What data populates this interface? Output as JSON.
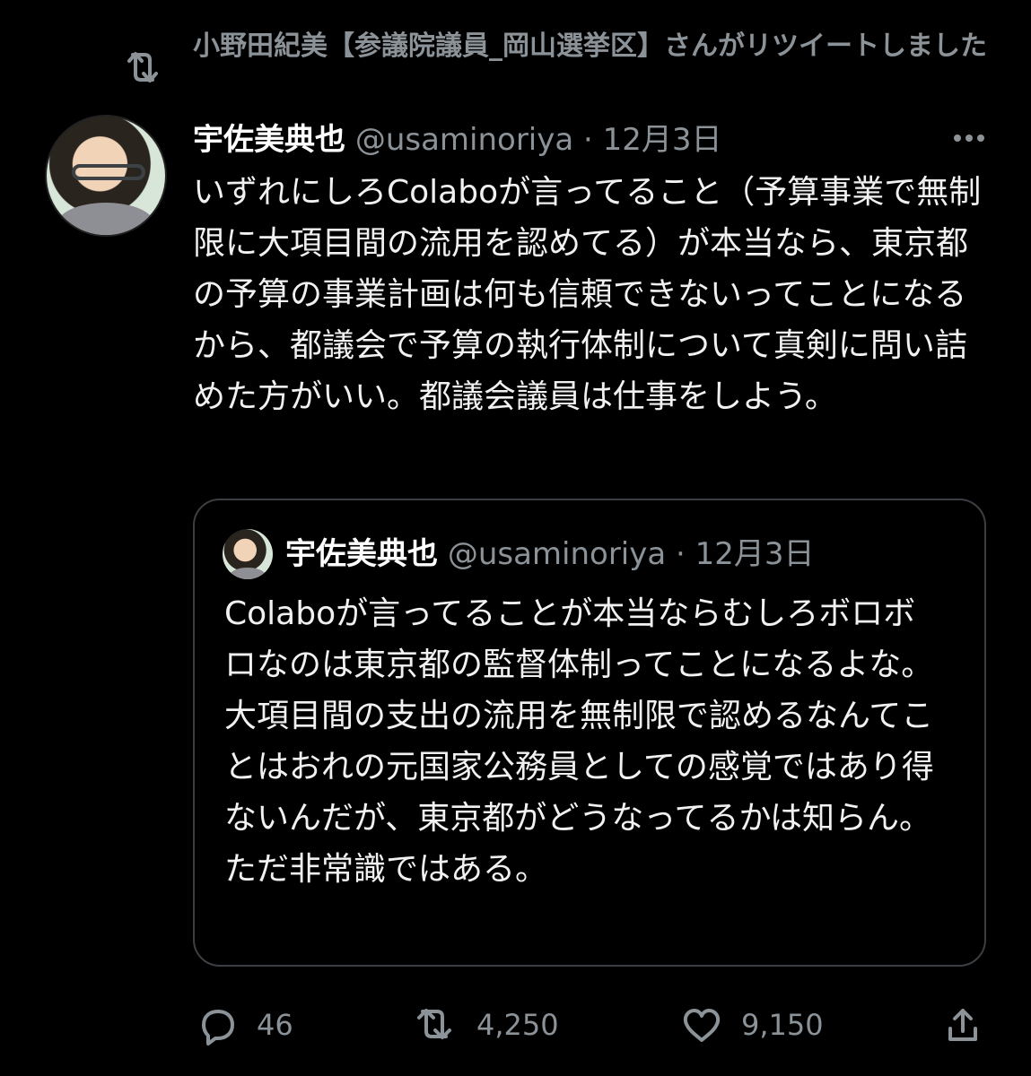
{
  "retweet": {
    "text": "小野田紀美【参議院議員_岡山選挙区】さんがリツイートしました"
  },
  "tweet": {
    "author_name": "宇佐美典也",
    "handle": "@usaminoriya",
    "separator": "·",
    "date": "12月3日",
    "text": "いずれにしろColaboが言ってること（予算事業で無制限に大項目間の流用を認めてる）が本当なら、東京都の予算の事業計画は何も信頼できないってことになるから、都議会で予算の執行体制について真剣に問い詰めた方がいい。都議会議員は仕事をしよう。"
  },
  "quote": {
    "author_name": "宇佐美典也",
    "handle": "@usaminoriya",
    "separator": "·",
    "date": "12月3日",
    "text": "Colaboが言ってることが本当ならむしろボロボロなのは東京都の監督体制ってことになるよな。\n大項目間の支出の流用を無制限で認めるなんてことはおれの元国家公務員としての感覚ではあり得ないんだが、東京都がどうなってるかは知らん。ただ非常識ではある。"
  },
  "actions": {
    "reply_count": "46",
    "retweet_count": "4,250",
    "like_count": "9,150"
  },
  "icons": {
    "retweet": "retweet-icon",
    "more": "more-icon",
    "reply": "reply-icon",
    "like": "heart-icon",
    "share": "share-icon"
  },
  "colors": {
    "background": "#000000",
    "text": "#f1f1f1",
    "muted": "#8b9298",
    "border": "#3b3f44"
  }
}
